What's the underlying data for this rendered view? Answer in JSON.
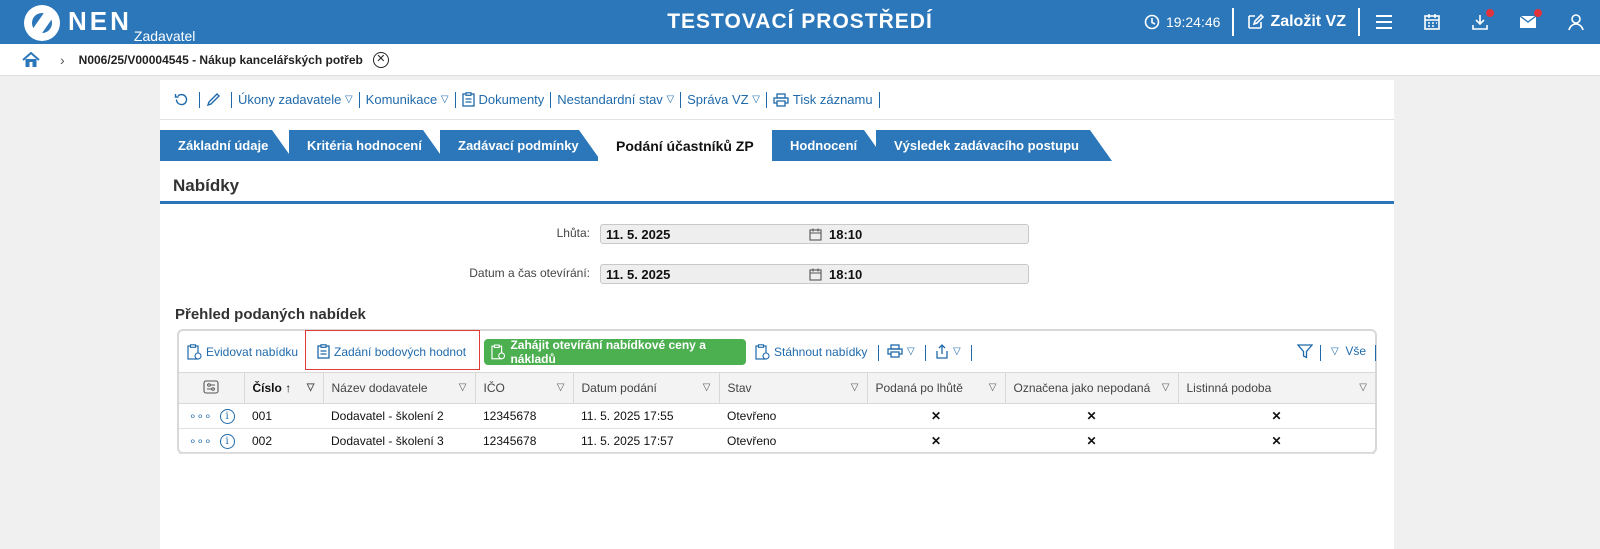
{
  "header": {
    "logo_text": "NEN",
    "logo_sub": "Zadavatel",
    "env_title": "TESTOVACÍ PROSTŘEDÍ",
    "clock": "19:24:46",
    "new_vz_label": "Založit VZ",
    "brand_color": "#2b77b9"
  },
  "breadcrumb": {
    "title": "N006/25/V00004545 - Nákup kancelářských potřeb"
  },
  "toolbar": {
    "ukony": "Úkony zadavatele",
    "komunikace": "Komunikace",
    "dokumenty": "Dokumenty",
    "nestandardni": "Nestandardní stav",
    "sprava": "Správa VZ",
    "tisk": "Tisk záznamu"
  },
  "tabs": [
    {
      "label": "Základní údaje"
    },
    {
      "label": "Kritéria hodnocení"
    },
    {
      "label": "Zadávací podmínky"
    },
    {
      "label": "Podání účastníků ZP"
    },
    {
      "label": "Hodnocení"
    },
    {
      "label": "Výsledek zadávacího postupu"
    }
  ],
  "section": {
    "title": "Nabídky",
    "lhuta_label": "Lhůta:",
    "lhuta_date": "11. 5. 2025",
    "lhuta_time": "18:10",
    "otevirani_label": "Datum a čas otevírání:",
    "otevirani_date": "11. 5. 2025",
    "otevirani_time": "18:10",
    "subtitle": "Přehled podaných nabídek"
  },
  "grid_toolbar": {
    "evidovat": "Evidovat nabídku",
    "zadani": "Zadání bodových hodnot",
    "zahajit": "Zahájit otevírání nabídkové ceny a nákladů",
    "stahnout": "Stáhnout nabídky",
    "vse": "Vše",
    "accent_green": "#4caf50"
  },
  "columns": {
    "cislo": "Číslo",
    "nazev": "Název dodavatele",
    "ico": "IČO",
    "datum": "Datum podání",
    "stav": "Stav",
    "po_lhute": "Podaná po lhůtě",
    "nepodana": "Označena jako nepodaná",
    "listinna": "Listinná podoba"
  },
  "rows": [
    {
      "cislo": "001",
      "nazev": "Dodavatel - školení 2",
      "ico": "12345678",
      "datum": "11. 5. 2025 17:55",
      "stav": "Otevřeno"
    },
    {
      "cislo": "002",
      "nazev": "Dodavatel - školení 3",
      "ico": "12345678",
      "datum": "11. 5. 2025 17:57",
      "stav": "Otevřeno"
    }
  ],
  "row_marks": {
    "no": "✕",
    "dots": "∘∘∘",
    "info": "i"
  }
}
